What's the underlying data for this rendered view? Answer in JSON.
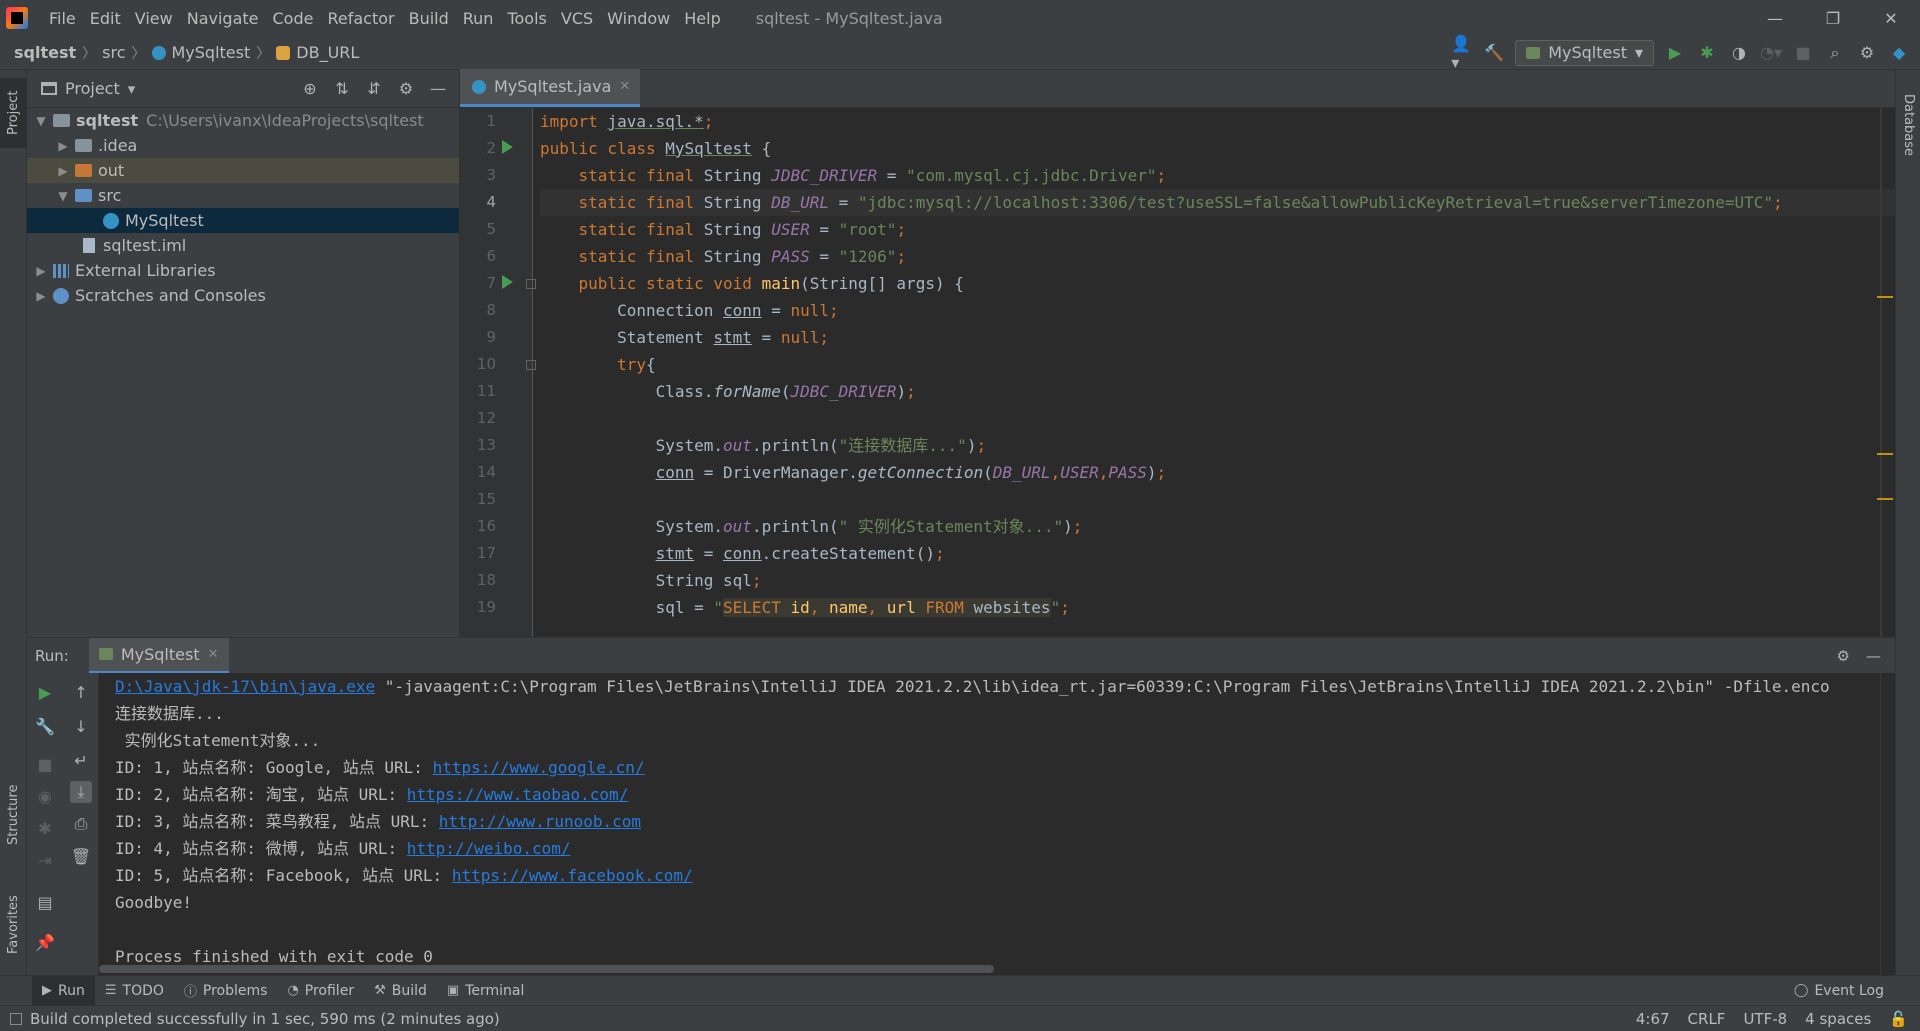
{
  "window": {
    "title": "sqltest - MySqltest.java",
    "controls": [
      "—",
      "❐",
      "✕"
    ]
  },
  "menu": [
    "File",
    "Edit",
    "View",
    "Navigate",
    "Code",
    "Refactor",
    "Build",
    "Run",
    "Tools",
    "VCS",
    "Window",
    "Help"
  ],
  "breadcrumb": {
    "project": "sqltest",
    "folder": "src",
    "cls": "MySqltest",
    "field": "DB_URL"
  },
  "run_config": {
    "name": "MySqltest"
  },
  "side_tabs": {
    "project": "Project",
    "structure": "Structure",
    "favorites": "Favorites",
    "database": "Database"
  },
  "project_panel": {
    "title": "Project",
    "tree": [
      {
        "label": "sqltest",
        "path": "C:\\Users\\ivanx\\IdeaProjects\\sqltest"
      },
      {
        "label": ".idea"
      },
      {
        "label": "out"
      },
      {
        "label": "src"
      },
      {
        "label": "MySqltest"
      },
      {
        "label": "sqltest.iml"
      },
      {
        "label": "External Libraries"
      },
      {
        "label": "Scratches and Consoles"
      }
    ]
  },
  "editor": {
    "tab": "MySqltest.java",
    "inspections": {
      "warnings": "4",
      "ok": "1"
    },
    "line_numbers": [
      "1",
      "2",
      "3",
      "4",
      "5",
      "6",
      "7",
      "8",
      "9",
      "10",
      "11",
      "12",
      "13",
      "14",
      "15",
      "16",
      "17",
      "18",
      "19"
    ],
    "code": {
      "l1a": "import ",
      "l1b": "java.sql.*",
      "l1c": ";",
      "l2a": "public class ",
      "l2b": "MySqltest",
      "l2c": " {",
      "l3a": "    static final ",
      "l3b": "String ",
      "l3c": "JDBC_DRIVER",
      "l3d": " = ",
      "l3e": "\"com.mysql.cj.jdbc.Driver\"",
      "l3f": ";",
      "l4a": "    static final ",
      "l4b": "String ",
      "l4c": "DB_URL",
      "l4d": " = ",
      "l4e": "\"jdbc:mysql://localhost:3306/test?useSSL=false&allowPublicKeyRetrieval=true&serverTimezone=UTC\"",
      "l4f": ";",
      "l5a": "    static final ",
      "l5b": "String ",
      "l5c": "USER",
      "l5d": " = ",
      "l5e": "\"root\"",
      "l5f": ";",
      "l6a": "    static final ",
      "l6b": "String ",
      "l6c": "PASS",
      "l6d": " = ",
      "l6e": "\"1206\"",
      "l6f": ";",
      "l7a": "    public static void ",
      "l7b": "main",
      "l7c": "(String[] args) {",
      "l8a": "        Connection ",
      "l8b": "conn",
      "l8c": " = ",
      "l8d": "null",
      "l8e": ";",
      "l9a": "        Statement ",
      "l9b": "stmt",
      "l9c": " = ",
      "l9d": "null",
      "l9e": ";",
      "l10a": "        try",
      "l10b": "{",
      "l11a": "            Class.",
      "l11b": "forName",
      "l11c": "(",
      "l11d": "JDBC_DRIVER",
      "l11e": ")",
      "l11f": ";",
      "l13a": "            System.",
      "l13b": "out",
      "l13c": ".println(",
      "l13d": "\"连接数据库...\"",
      "l13e": ")",
      "l13f": ";",
      "l14a": "            ",
      "l14b": "conn",
      "l14c": " = DriverManager.",
      "l14d": "getConnection",
      "l14e": "(",
      "l14f": "DB_URL",
      "l14g": ",",
      "l14h": "USER",
      "l14i": ",",
      "l14j": "PASS",
      "l14k": ")",
      "l14l": ";",
      "l16a": "            System.",
      "l16b": "out",
      "l16c": ".println(",
      "l16d": "\" 实例化Statement对象...\"",
      "l16e": ")",
      "l16f": ";",
      "l17a": "            ",
      "l17b": "stmt",
      "l17c": " = ",
      "l17d": "conn",
      "l17e": ".createStatement()",
      "l17f": ";",
      "l18a": "            String sql",
      "l18b": ";",
      "l19a": "            sql = ",
      "l19b": "\"",
      "l19c": "SELECT ",
      "l19d": "id",
      "l19e": ", ",
      "l19f": "name",
      "l19g": ", ",
      "l19h": "url ",
      "l19i": "FROM ",
      "l19j": "websites",
      "l19k": "\"",
      "l19l": ";"
    }
  },
  "run_panel": {
    "label": "Run:",
    "tab": "MySqltest",
    "console": {
      "cmd_link": "D:\\Java\\jdk-17\\bin\\java.exe",
      "cmd_rest": " \"-javaagent:C:\\Program Files\\JetBrains\\IntelliJ IDEA 2021.2.2\\lib\\idea_rt.jar=60339:C:\\Program Files\\JetBrains\\IntelliJ IDEA 2021.2.2\\bin\" -Dfile.enco",
      "line2": "连接数据库...",
      "line3": " 实例化Statement对象...",
      "rows": [
        {
          "prefix": "ID: 1, 站点名称: Google, 站点 URL: ",
          "url": "https://www.google.cn/"
        },
        {
          "prefix": "ID: 2, 站点名称: 淘宝, 站点 URL: ",
          "url": "https://www.taobao.com/"
        },
        {
          "prefix": "ID: 3, 站点名称: 菜鸟教程, 站点 URL: ",
          "url": "http://www.runoob.com"
        },
        {
          "prefix": "ID: 4, 站点名称: 微博, 站点 URL: ",
          "url": "http://weibo.com/"
        },
        {
          "prefix": "ID: 5, 站点名称: Facebook, 站点 URL: ",
          "url": "https://www.facebook.com/"
        }
      ],
      "goodbye": "Goodbye!",
      "exit": "Process finished with exit code 0"
    }
  },
  "bottom_tabs": [
    "Run",
    "TODO",
    "Problems",
    "Profiler",
    "Build",
    "Terminal"
  ],
  "event_log": "Event Log",
  "status": {
    "message": "Build completed successfully in 1 sec, 590 ms (2 minutes ago)",
    "position": "4:67",
    "line_sep": "CRLF",
    "encoding": "UTF-8",
    "indent": "4 spaces"
  },
  "colors": {
    "background": "#2b2b2b",
    "panel": "#3c3f41",
    "keyword": "#cc7832",
    "string": "#6a8759",
    "constant": "#9876aa",
    "function": "#ffc66d",
    "link": "#287bde",
    "run_green": "#499c54"
  }
}
